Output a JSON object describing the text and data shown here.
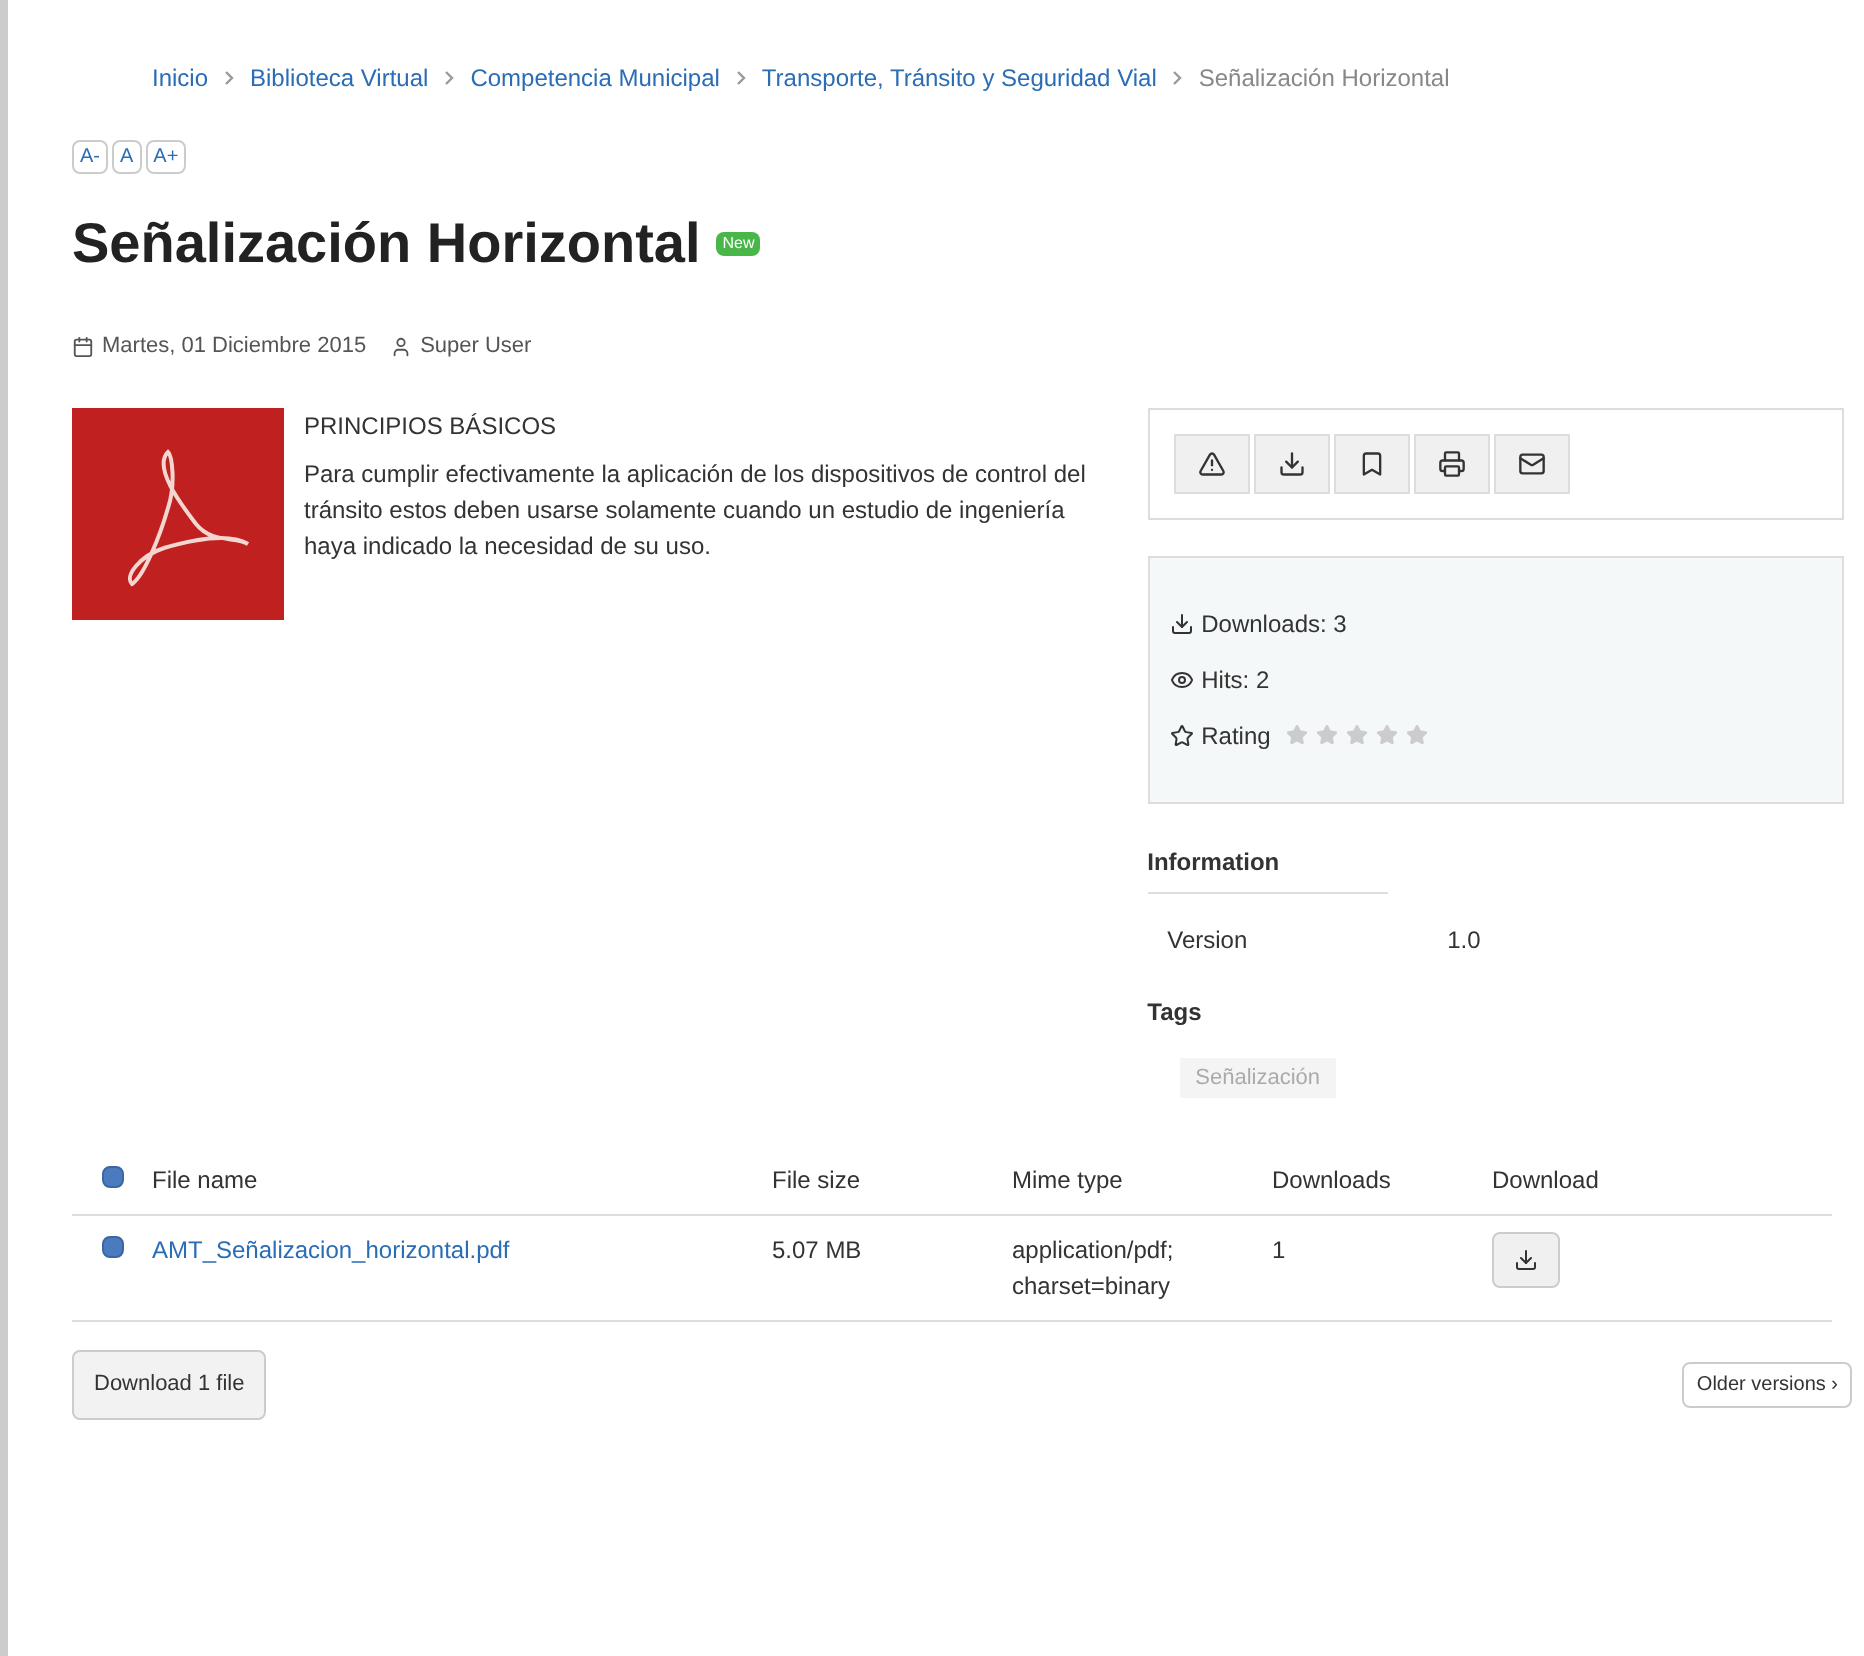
{
  "breadcrumb": [
    {
      "label": "Inicio",
      "current": false
    },
    {
      "label": "Biblioteca Virtual",
      "current": false
    },
    {
      "label": "Competencia Municipal",
      "current": false
    },
    {
      "label": "Transporte, Tránsito y Seguridad Vial",
      "current": false
    },
    {
      "label": "Señalización Horizontal",
      "current": true
    }
  ],
  "font_buttons": [
    "A-",
    "A",
    "A+"
  ],
  "title": "Señalización Horizontal",
  "badge": "New",
  "meta": {
    "date": "Martes, 01 Diciembre 2015",
    "author": "Super User"
  },
  "description": {
    "heading": "PRINCIPIOS BÁSICOS",
    "body": "Para cumplir efectivamente la aplicación de los dispositivos de control del tránsito estos deben usarse solamente cuando un estudio de ingeniería haya indicado la necesidad de su uso."
  },
  "actions": [
    {
      "kind": "warning"
    },
    {
      "kind": "download"
    },
    {
      "kind": "bookmark"
    },
    {
      "kind": "print"
    },
    {
      "kind": "email"
    }
  ],
  "stats": {
    "downloads": "Downloads: 3",
    "hits": "Hits: 2",
    "rating_label": "Rating",
    "stars": 0
  },
  "information": {
    "heading": "Information",
    "rows": [
      {
        "label": "Version",
        "value": "1.0"
      }
    ]
  },
  "tags": {
    "heading": "Tags",
    "items": [
      "Señalización"
    ]
  },
  "table": {
    "columns": [
      "File name",
      "File size",
      "Mime type",
      "Downloads",
      "Download"
    ],
    "header_checked": true,
    "rows": [
      {
        "checked": true,
        "name": "AMT_Señalizacion_horizontal.pdf",
        "size": "5.07 MB",
        "mime": "application/pdf; charset=binary",
        "downloads": "1"
      }
    ]
  },
  "download_button": "Download 1 file",
  "older_versions": "Older versions ›"
}
